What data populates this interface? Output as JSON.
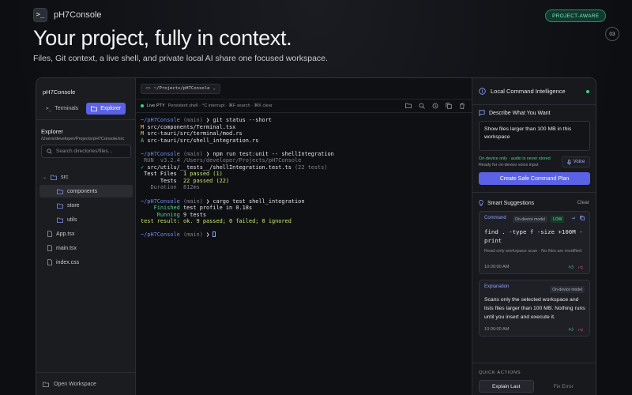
{
  "app": {
    "brand_name": "pH7Console",
    "logo_glyph": ">_",
    "badge": "PROJECT-AWARE",
    "step": "03"
  },
  "hero": {
    "title": "Your project, fully in context.",
    "subtitle": "Files, Git context, a live shell, and private local AI share one focused workspace."
  },
  "sidebar": {
    "title": "pH7Console",
    "tabs": [
      {
        "label": "Terminals",
        "active": false
      },
      {
        "label": "Explorer",
        "active": true
      }
    ],
    "explorer_heading": "Explorer",
    "path": "/Users/developer/Projects/pH7Console/src",
    "search_placeholder": "Search directories/files...",
    "tree": [
      {
        "label": "src",
        "type": "folder",
        "expanded": true
      },
      {
        "label": "components",
        "type": "folder",
        "selected": true
      },
      {
        "label": "store",
        "type": "folder"
      },
      {
        "label": "utils",
        "type": "folder"
      },
      {
        "label": "App.tsx",
        "type": "file"
      },
      {
        "label": "main.tsx",
        "type": "file"
      },
      {
        "label": "index.css",
        "type": "file"
      }
    ],
    "footer": "Open Workspace"
  },
  "terminal": {
    "path_chip": "~/Projects/pH7Console",
    "status_live": "Live PTY",
    "status_hint": "Persistent shell · ^C interrupt · ⌘F search · ⌘K clear",
    "prompt_user": "~/pH7Console",
    "prompt_branch": "(main)",
    "lines": {
      "cmd1": "git status --short",
      "git1_flag": "M",
      "git1_file": "src/components/Terminal.tsx",
      "git2_flag": "M",
      "git2_file": "src-tauri/src/terminal/mod.rs",
      "git3_flag": "A",
      "git3_file": "src-tauri/src/shell_integration.rs",
      "cmd2": "npm run test:unit -- shellIntegration",
      "run_tag": "RUN",
      "run_text": "v3.2.4 /Users/developer/Projects/pH7Console",
      "pass_mark": "✓",
      "pass_file": "src/utils/__tests__/shellIntegration.test.ts",
      "pass_count": "(22 tests)",
      "files_label": "Test Files",
      "files_value": "1 passed (1)",
      "tests_label": "Tests",
      "tests_value": "22 passed (22)",
      "duration_label": "Duration",
      "duration_value": "812ms",
      "cmd3": "cargo test shell_integration",
      "finished_label": "Finished",
      "finished_value": "test profile in 0.18s",
      "running_label": "Running",
      "running_value": "9 tests",
      "result_label": "test result:",
      "result_value": "ok. 9 passed; 0 failed; 0 ignored"
    }
  },
  "panel": {
    "title": "Local Command Intelligence",
    "describe_label": "Describe What You Want",
    "prompt_text": "Show files larger than 100 MB in this workspace",
    "hint_private": "On-device only · audio is never stored",
    "hint_ready": "Ready for on-device voice input",
    "voice_label": "Voice",
    "create_button": "Create Safe Command Plan",
    "suggestions_label": "Smart Suggestions",
    "clear_label": "Clear",
    "card1": {
      "tag": "Command",
      "model_chip": "On-device model",
      "risk_chip": "LOW",
      "command": "find . -type f -size +100M -print",
      "note": "Read-only workspace scan · No files are modified",
      "time": "10:00:00 AM"
    },
    "card2": {
      "tag": "Explanation",
      "model_chip": "On-device model",
      "text": "Scans only the selected workspace and lists files larger than 100 MB. Nothing runs until you insert and execute it.",
      "time": "10:00:00 AM"
    },
    "quick_actions_label": "QUICK ACTIONS",
    "quick_actions": [
      {
        "label": "Explain Last",
        "active": true
      },
      {
        "label": "Fix Error",
        "active": false
      }
    ]
  },
  "colors": {
    "accent": "#5b62e6",
    "success": "#3ccf8e",
    "danger": "#e05b6b"
  }
}
